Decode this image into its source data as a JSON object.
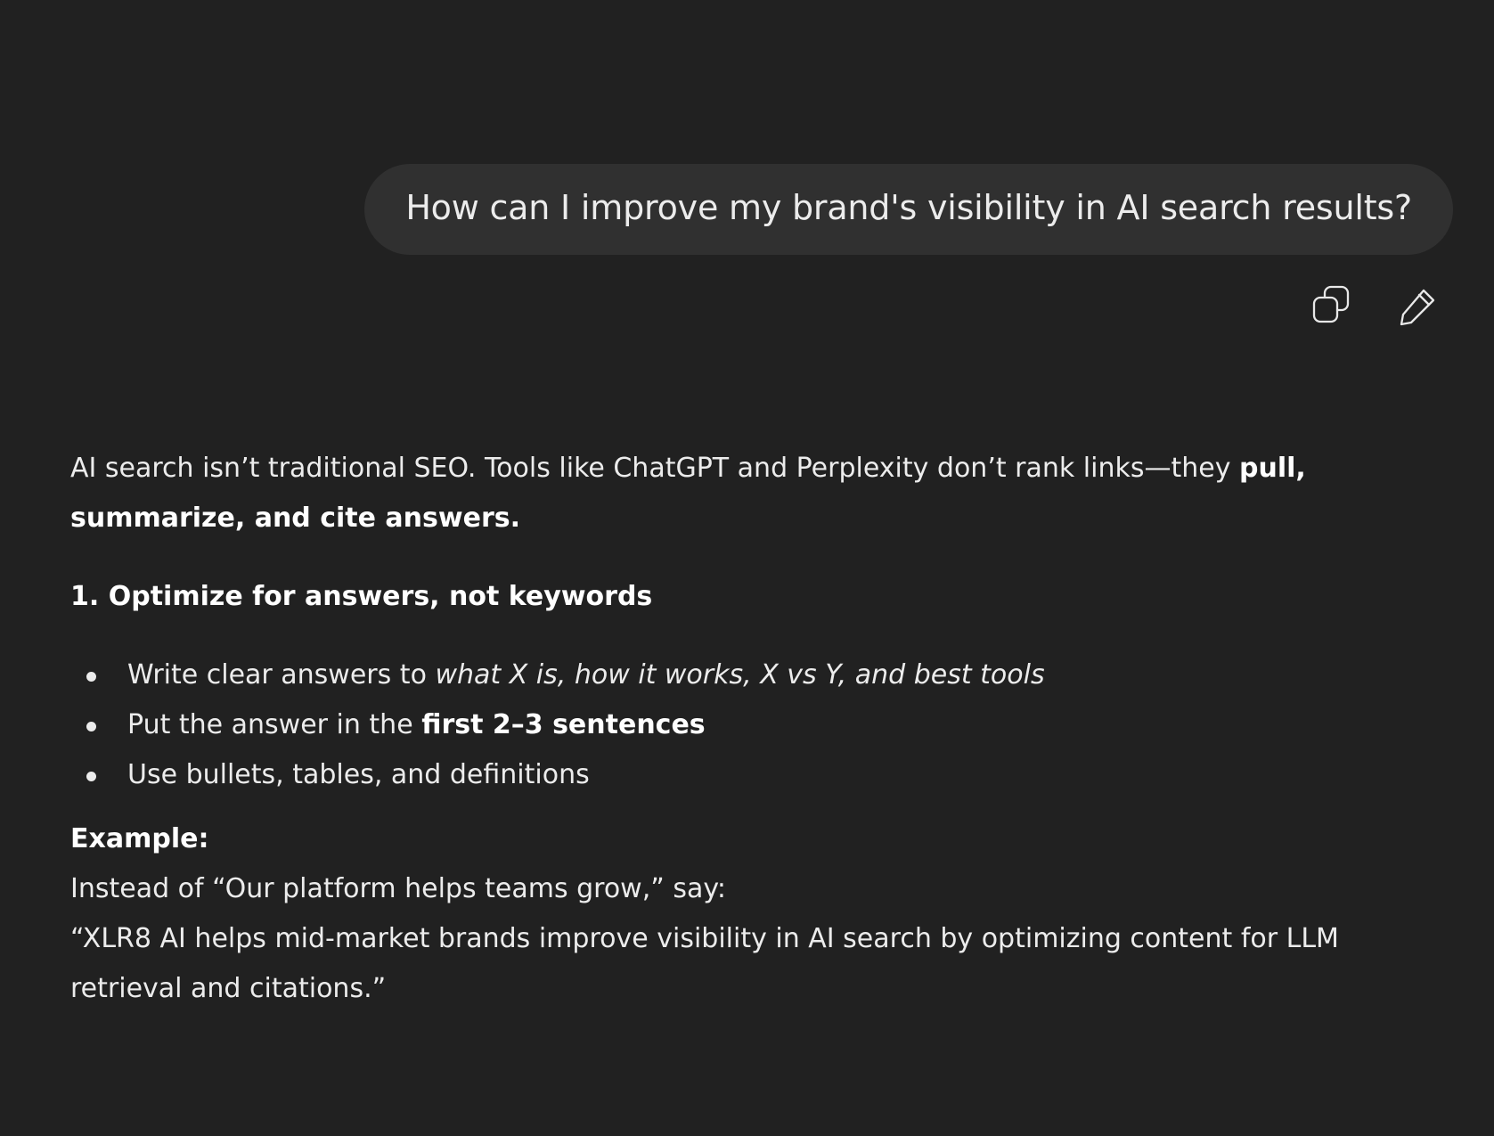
{
  "user_message": {
    "text": "How can I improve my brand's visibility in AI search results?",
    "actions": [
      {
        "name": "copy-icon"
      },
      {
        "name": "edit-icon"
      }
    ]
  },
  "assistant_message": {
    "intro_plain": "AI search isn’t traditional SEO. Tools like ChatGPT and Perplexity don’t rank links—they ",
    "intro_bold": "pull, summarize, and cite answers.",
    "section1_heading": "1. Optimize for answers, not keywords",
    "bullets": [
      {
        "plain": "Write clear answers to ",
        "italic": "what X is, how it works, X vs Y, and best tools"
      },
      {
        "plain": "Put the answer in the ",
        "bold": "first 2–3 sentences"
      },
      {
        "plain": "Use bullets, tables, and definitions"
      }
    ],
    "example_label": "Example:",
    "example_line1": "Instead of “Our platform helps teams grow,” say:",
    "example_line2": "“XLR8 AI helps mid-market brands improve visibility in AI search by optimizing content for LLM retrieval and citations.”"
  }
}
